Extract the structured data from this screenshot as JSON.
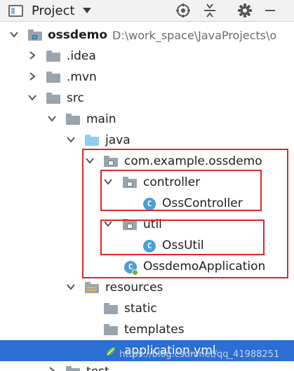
{
  "header": {
    "title": "Project",
    "icons": [
      "project-view-icon",
      "chevron-down-icon",
      "locate-icon",
      "collapse-all-icon",
      "gear-icon",
      "minimize-icon"
    ]
  },
  "tree": {
    "root_label": "ossdemo",
    "root_path": "D:\\work_space\\JavaProjects\\o",
    "idea": ".idea",
    "mvn": ".mvn",
    "src": "src",
    "main": "main",
    "java": "java",
    "pkg": "com.example.ossdemo",
    "controller": "controller",
    "oss_controller": "OssController",
    "util": "util",
    "oss_util": "OssUtil",
    "app": "OssdemoApplication",
    "resources": "resources",
    "static": "static",
    "templates": "templates",
    "application_yml": "application.yml",
    "test": "test",
    "class_badge": "C"
  },
  "colors": {
    "selection": "#2b6ed4",
    "highlight_box": "#e0262b",
    "folder_gray": "#9aa4ad",
    "folder_blue": "#8ccff2",
    "class_badge": "#4b9fd5"
  },
  "watermark": "https://blog.csdn.net/qq_41988251"
}
